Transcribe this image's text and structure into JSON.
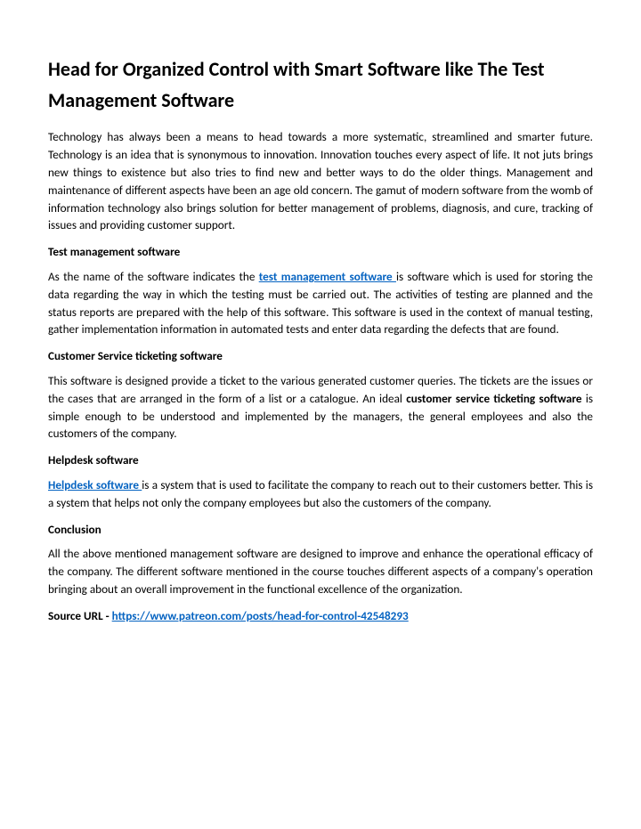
{
  "title": "Head for Organized Control with Smart Software like The Test Management Software",
  "intro": "Technology has always been a means to head towards a more systematic, streamlined and smarter future. Technology is an idea that is synonymous to innovation. Innovation touches every aspect of life. It not juts brings new things to existence but also tries to find new and better ways to do the older things. Management and maintenance of different aspects have been an age old concern. The gamut of modern software from the womb of information technology also brings solution for better management of problems, diagnosis, and cure, tracking of issues and providing customer support.",
  "section1_head": "Test management software",
  "section1_pre": "As the name of the software indicates the ",
  "section1_link": "test management software ",
  "section1_post": "is software which is used for storing the data regarding the way in which the testing must be carried out. The activities of testing are planned and the status reports are prepared with the help of this software. This software is used in the context of manual testing, gather implementation information in automated tests and enter data regarding the defects that are found.",
  "section2_head": "Customer Service ticketing software",
  "section2_pre": "This software is designed provide a ticket to the various generated customer queries. The tickets are the issues or the cases that are arranged in the form of a list or a catalogue. An ideal ",
  "section2_bold": "customer service ticketing software",
  "section2_post": " is simple enough to be understood and implemented by the managers, the general employees and also the customers of the company.",
  "section3_head": "Helpdesk software",
  "section3_link": "Helpdesk software ",
  "section3_post": "is a system that is used to facilitate the company to reach out to their customers better. This is a system that helps not only the company employees but also the customers of the company.",
  "section4_head": "Conclusion",
  "section4_body": "All the above mentioned management software are designed to improve and enhance the operational efficacy of the company. The different software mentioned in the course touches different aspects of a company's operation bringing about an overall improvement in the functional excellence of the organization.",
  "source_label": "Source URL - ",
  "source_url": "https://www.patreon.com/posts/head-for-control-42548293"
}
